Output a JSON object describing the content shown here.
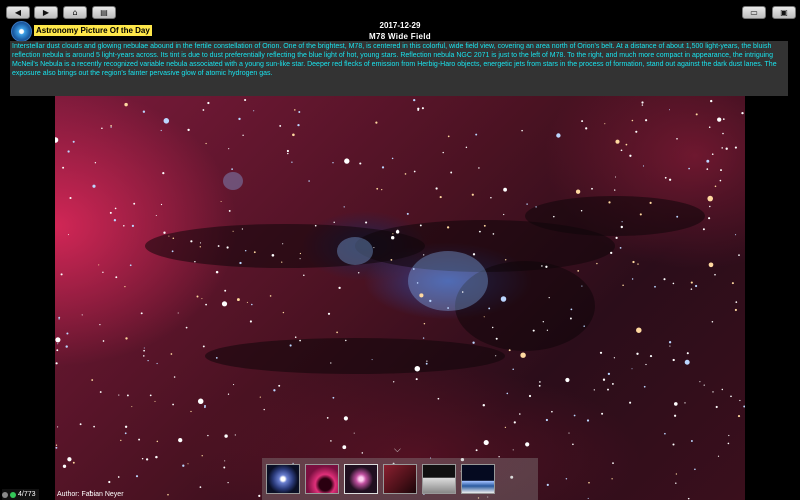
{
  "toolbar": {
    "back_icon": "◀",
    "forward_icon": "▶",
    "home_icon": "⌂",
    "calendar_icon": "▤",
    "slideshow_icon": "▭",
    "save_icon": "▣"
  },
  "header": {
    "app_title": "Astronomy Picture Of the Day",
    "date": "2017-12-29",
    "picture_title": "M78 Wide Field"
  },
  "description": "Interstellar dust clouds and glowing nebulae abound in the fertile constellation of Orion. One of the brightest, M78, is centered in this colorful, wide field view, covering an area north of Orion's belt. At a distance of about 1,500 light-years, the bluish reflection nebula is around 5 light-years across. Its tint is due to dust preferentially reflecting the blue light of hot, young stars. Reflection nebula NGC 2071 is just to the left of M78. To the right, and much more compact in appearance, the intriguing McNeil's Nebula is a recently recognized variable nebula associated with a young sun-like star. Deeper red flecks of emission from Herbig-Haro objects, energetic jets from stars in the process of formation, stand out against the dark dust lanes. The exposure also brings out the region's fainter pervasive glow of atomic hydrogen gas.",
  "footer": {
    "expand_icon": "⌵",
    "counter": "4/773",
    "author": "Author: Fabian Neyer"
  },
  "colors": {
    "title_highlight": "#ffe84a",
    "description_text": "#19e4ee",
    "status_gray": "#8a8a8a",
    "status_green": "#34c759"
  }
}
